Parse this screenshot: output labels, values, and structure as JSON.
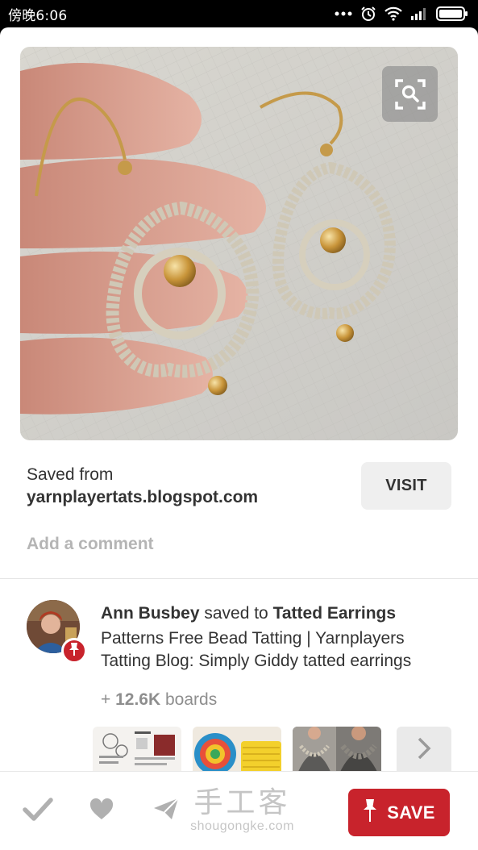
{
  "status_bar": {
    "time": "傍晚6:06",
    "icons": [
      "more-dots-icon",
      "alarm-icon",
      "wifi-icon",
      "signal-icon",
      "battery-icon"
    ]
  },
  "pin": {
    "image_alt": "tatted earrings with gold beads held in a hand",
    "visual_search_icon": "visual-search-icon"
  },
  "source": {
    "saved_from_label": "Saved from",
    "domain": "yarnplayertats.blogspot.com",
    "visit_label": "VISIT"
  },
  "comment": {
    "placeholder": "Add a comment"
  },
  "attribution": {
    "user": "Ann Busbey",
    "saved_to": " saved to ",
    "board": "Tatted Earrings",
    "description": "Patterns Free Bead Tatting | Yarnplayers Tatting Blog: Simply Giddy tatted earrings"
  },
  "boards": {
    "prefix": "+ ",
    "count": "12.6K",
    "suffix": " boards"
  },
  "actions": {
    "save_label": "SAVE"
  },
  "watermark": {
    "main": "手工客",
    "sub": "shougongke.com"
  },
  "colors": {
    "brand_red": "#c8232c",
    "text": "#333333",
    "muted": "#8e8e8e",
    "placeholder": "#b5b5b5"
  }
}
